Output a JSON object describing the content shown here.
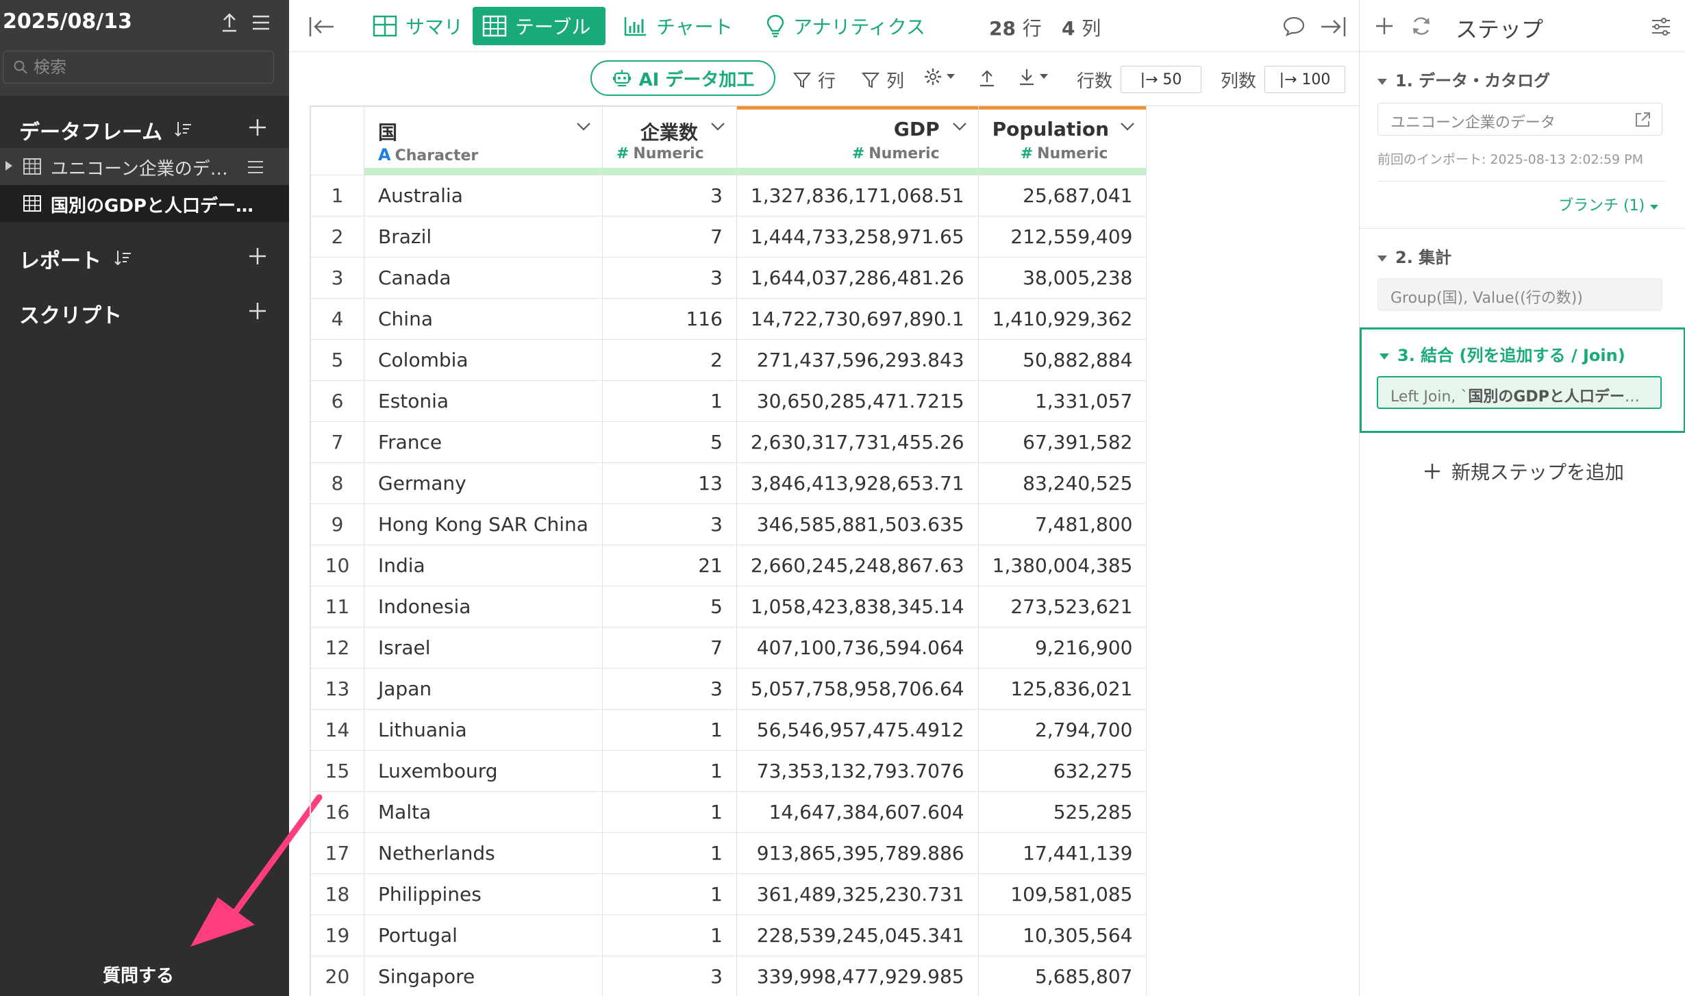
{
  "sidebar": {
    "date": "2025/08/13",
    "search_placeholder": "検索",
    "sections": {
      "dataframes": "データフレーム",
      "reports": "レポート",
      "scripts": "スクリプト"
    },
    "dataframe_items": [
      "ユニコーン企業のデータ",
      "国別のGDPと人口データ…"
    ],
    "question_label": "質問する",
    "colors": {
      "background": "#2e2e2e",
      "header": "#3b3b3b",
      "arrow": "#ff3d7f"
    }
  },
  "toolbar": {
    "summary": "サマリ",
    "table": "テーブル",
    "chart": "チャート",
    "analytics": "アナリティクス",
    "rows_count": "28",
    "rows_unit": "行",
    "cols_count": "4",
    "cols_unit": "列",
    "accent": "#1aa97a"
  },
  "subtoolbar": {
    "ai_label": "AI データ加工",
    "filter_rows": "行",
    "filter_cols": "列",
    "rows_label": "行数",
    "rows_value": "|→ 50",
    "cols_label": "列数",
    "cols_value": "|→ 100"
  },
  "table": {
    "columns": [
      {
        "name": "国",
        "type": "Character",
        "type_icon": "A"
      },
      {
        "name": "企業数",
        "type": "Numeric",
        "type_icon": "#"
      },
      {
        "name": "GDP",
        "type": "Numeric",
        "type_icon": "#"
      },
      {
        "name": "Population",
        "type": "Numeric",
        "type_icon": "#"
      }
    ],
    "rows": [
      [
        "1",
        "Australia",
        "3",
        "1,327,836,171,068.51",
        "25,687,041"
      ],
      [
        "2",
        "Brazil",
        "7",
        "1,444,733,258,971.65",
        "212,559,409"
      ],
      [
        "3",
        "Canada",
        "3",
        "1,644,037,286,481.26",
        "38,005,238"
      ],
      [
        "4",
        "China",
        "116",
        "14,722,730,697,890.1",
        "1,410,929,362"
      ],
      [
        "5",
        "Colombia",
        "2",
        "271,437,596,293.843",
        "50,882,884"
      ],
      [
        "6",
        "Estonia",
        "1",
        "30,650,285,471.7215",
        "1,331,057"
      ],
      [
        "7",
        "France",
        "5",
        "2,630,317,731,455.26",
        "67,391,582"
      ],
      [
        "8",
        "Germany",
        "13",
        "3,846,413,928,653.71",
        "83,240,525"
      ],
      [
        "9",
        "Hong Kong SAR China",
        "3",
        "346,585,881,503.635",
        "7,481,800"
      ],
      [
        "10",
        "India",
        "21",
        "2,660,245,248,867.63",
        "1,380,004,385"
      ],
      [
        "11",
        "Indonesia",
        "5",
        "1,058,423,838,345.14",
        "273,523,621"
      ],
      [
        "12",
        "Israel",
        "7",
        "407,100,736,594.064",
        "9,216,900"
      ],
      [
        "13",
        "Japan",
        "3",
        "5,057,758,958,706.64",
        "125,836,021"
      ],
      [
        "14",
        "Lithuania",
        "1",
        "56,546,957,475.4912",
        "2,794,700"
      ],
      [
        "15",
        "Luxembourg",
        "1",
        "73,353,132,793.7076",
        "632,275"
      ],
      [
        "16",
        "Malta",
        "1",
        "14,647,384,607.604",
        "525,285"
      ],
      [
        "17",
        "Netherlands",
        "1",
        "913,865,395,789.886",
        "17,441,139"
      ],
      [
        "18",
        "Philippines",
        "1",
        "361,489,325,230.731",
        "109,581,085"
      ],
      [
        "19",
        "Portugal",
        "1",
        "228,539,245,045.341",
        "10,305,564"
      ],
      [
        "20",
        "Singapore",
        "3",
        "339,998,477,929.985",
        "5,685,807"
      ]
    ]
  },
  "steps_panel": {
    "title": "ステップ",
    "steps": [
      {
        "title": "1. データ・カタログ",
        "box": "ユニコーン企業のデータ",
        "note": "前回のインポート: 2025-08-13 2:02:59 PM"
      },
      {
        "title": "2. 集計",
        "box": "Group(国), Value((行の数))"
      },
      {
        "title": "3. 結合 (列を追加する / Join)",
        "box_prefix": "Left Join, `",
        "box_bold": "国別のGDPと人口データ…"
      }
    ],
    "branch_label": "ブランチ (1)",
    "add_step_label": "新規ステップを追加"
  }
}
